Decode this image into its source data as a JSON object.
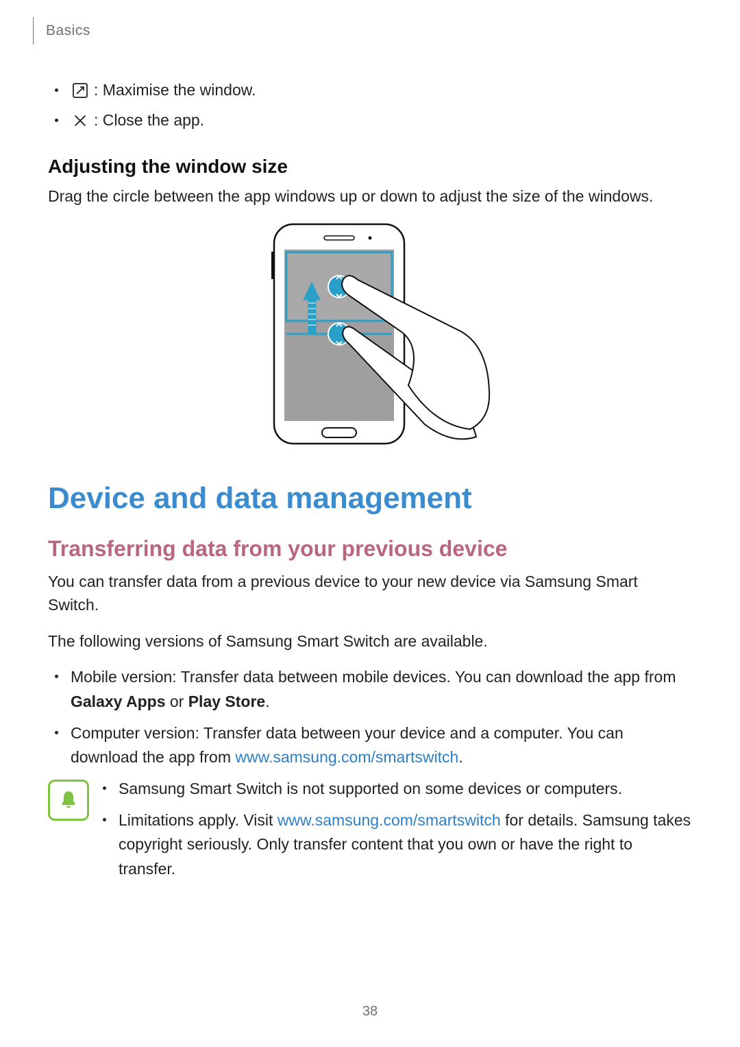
{
  "colors": {
    "h1": "#3b8bcf",
    "h2": "#b8677e",
    "link": "#2f7fc6",
    "noteBorder": "#7fc241",
    "noteFill": "#7fc241"
  },
  "header": {
    "section": "Basics"
  },
  "iconBullets": [
    {
      "icon": "maximise-icon",
      "text": " : Maximise the window."
    },
    {
      "icon": "close-icon",
      "text": " : Close the app."
    }
  ],
  "adjust": {
    "heading": "Adjusting the window size",
    "body": "Drag the circle between the app windows up or down to adjust the size of the windows."
  },
  "section": {
    "title": "Device and data management"
  },
  "transfer": {
    "heading": "Transferring data from your previous device",
    "p1": "You can transfer data from a previous device to your new device via Samsung Smart Switch.",
    "p2": "The following versions of Samsung Smart Switch are available.",
    "items": [
      {
        "pre": "Mobile version: Transfer data between mobile devices. You can download the app from ",
        "bold1": "Galaxy Apps",
        "mid": " or ",
        "bold2": "Play Store",
        "post": "."
      },
      {
        "pre": "Computer version: Transfer data between your device and a computer. You can download the app from ",
        "link": "www.samsung.com/smartswitch",
        "post": "."
      }
    ]
  },
  "note": {
    "items": [
      {
        "text": "Samsung Smart Switch is not supported on some devices or computers."
      },
      {
        "pre": "Limitations apply. Visit ",
        "link": "www.samsung.com/smartswitch",
        "post": " for details. Samsung takes copyright seriously. Only transfer content that you own or have the right to transfer."
      }
    ]
  },
  "pageNumber": "38"
}
